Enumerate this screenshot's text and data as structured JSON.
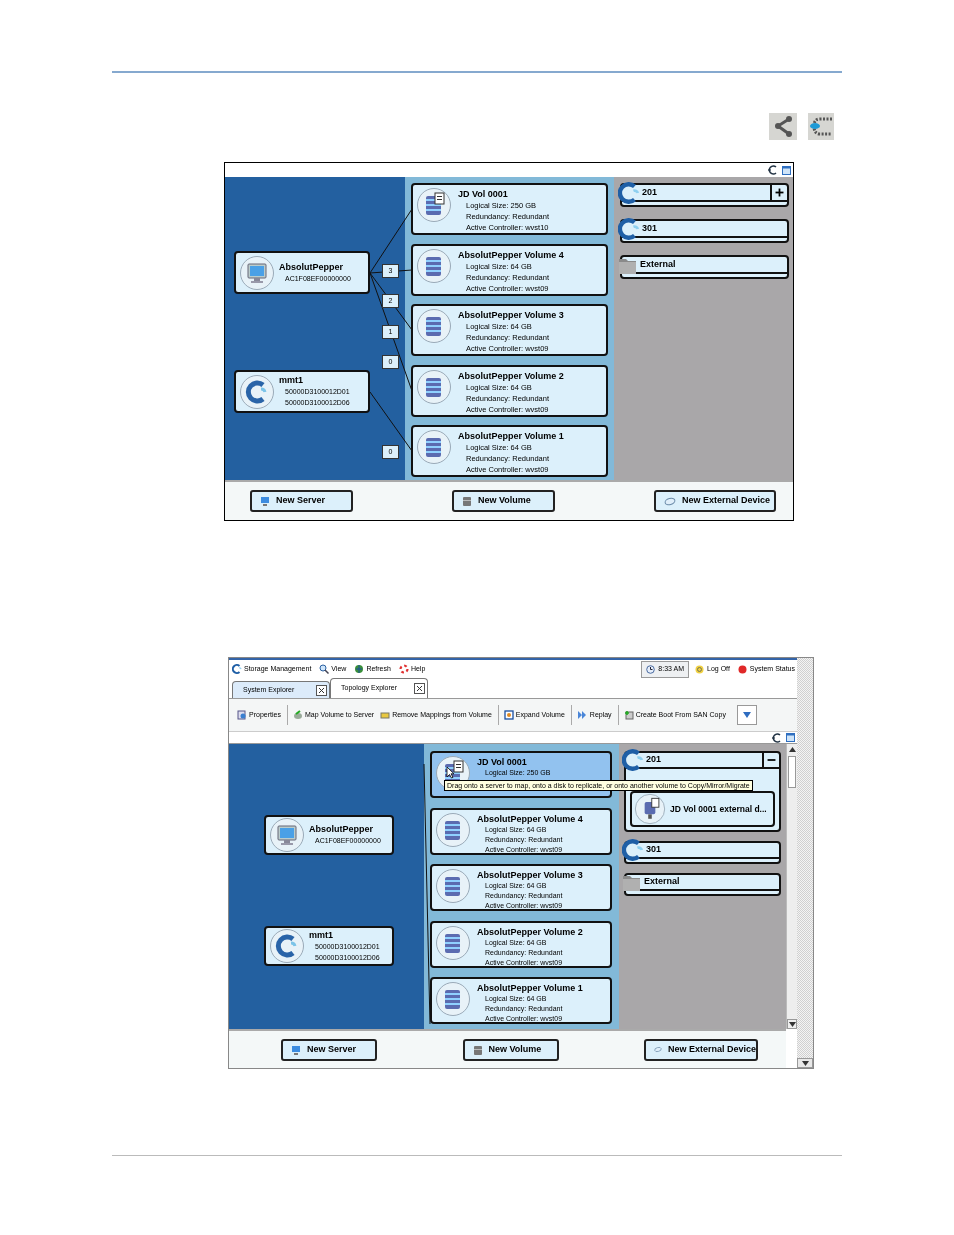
{
  "figures": [
    {
      "kind": "diagram",
      "topology": {
        "servers": [
          {
            "name": "AbsolutPepper",
            "kind": "server",
            "ids": [
              "AC1F08EF00000000"
            ]
          },
          {
            "name": "mmt1",
            "kind": "system",
            "ids": [
              "50000D3100012D01",
              "50000D3100012D06"
            ]
          }
        ],
        "mapping_counts": [
          "3",
          "2",
          "1",
          "0",
          "0"
        ],
        "volumes": [
          {
            "name": "JD Vol 0001",
            "kind": "copy",
            "selected": false,
            "details": [
              "Logical Size: 250 GB",
              "Redundancy: Redundant",
              "Active Controller: wvst10"
            ]
          },
          {
            "name": "AbsolutPepper Volume 4",
            "kind": "plain",
            "selected": false,
            "details": [
              "Logical Size: 64 GB",
              "Redundancy: Redundant",
              "Active Controller: wvst09"
            ]
          },
          {
            "name": "AbsolutPepper Volume 3",
            "kind": "plain",
            "selected": false,
            "details": [
              "Logical Size: 64 GB",
              "Redundancy: Redundant",
              "Active Controller: wvst09"
            ]
          },
          {
            "name": "AbsolutPepper Volume 2",
            "kind": "plain",
            "selected": false,
            "details": [
              "Logical Size: 64 GB",
              "Redundancy: Redundant",
              "Active Controller: wvst09"
            ]
          },
          {
            "name": "AbsolutPepper Volume 1",
            "kind": "plain",
            "selected": false,
            "details": [
              "Logical Size: 64 GB",
              "Redundancy: Redundant",
              "Active Controller: wvst09"
            ]
          }
        ],
        "devices": [
          {
            "name": "201",
            "kind": "replay",
            "expanded": false
          },
          {
            "name": "301",
            "kind": "replay"
          },
          {
            "name": "External",
            "kind": "folder"
          }
        ],
        "buttons": [
          "New Server",
          "New Volume",
          "New External Device"
        ]
      }
    },
    {
      "kind": "window",
      "menu": [
        "Storage Management",
        "View",
        "Refresh",
        "Help"
      ],
      "status": {
        "time": "8:33 AM",
        "items": [
          "Log Off",
          "System Status"
        ]
      },
      "tabs": [
        {
          "label": "System Explorer",
          "selected": false
        },
        {
          "label": "Topology Explorer",
          "selected": true
        }
      ],
      "toolbar": [
        [
          "Properties"
        ],
        [
          "Map Volume to Server",
          "Remove Mappings from Volume"
        ],
        [
          "Expand Volume"
        ],
        [
          "Replay"
        ],
        [
          "Create Boot From SAN Copy"
        ]
      ],
      "topology": {
        "servers": [
          {
            "name": "AbsolutPepper",
            "kind": "server",
            "ids": [
              "AC1F08EF00000000"
            ]
          },
          {
            "name": "mmt1",
            "kind": "system",
            "ids": [
              "50000D3100012D01",
              "50000D3100012D06"
            ]
          }
        ],
        "volumes": [
          {
            "name": "JD Vol 0001",
            "kind": "copy",
            "selected": true,
            "details": [
              "Logical Size: 250 GB"
            ],
            "tooltip": "Drag onto a server to map, onto a disk to replicate, or onto another volume to Copy/Mirror/Migrate"
          },
          {
            "name": "AbsolutPepper Volume 4",
            "kind": "plain",
            "selected": false,
            "details": [
              "Logical Size: 64 GB",
              "Redundancy: Redundant",
              "Active Controller: wvst09"
            ]
          },
          {
            "name": "AbsolutPepper Volume 3",
            "kind": "plain",
            "selected": false,
            "details": [
              "Logical Size: 64 GB",
              "Redundancy: Redundant",
              "Active Controller: wvst09"
            ]
          },
          {
            "name": "AbsolutPepper Volume 2",
            "kind": "plain",
            "selected": false,
            "details": [
              "Logical Size: 64 GB",
              "Redundancy: Redundant",
              "Active Controller: wvst09"
            ]
          },
          {
            "name": "AbsolutPepper Volume 1",
            "kind": "plain",
            "selected": false,
            "details": [
              "Logical Size: 64 GB",
              "Redundancy: Redundant",
              "Active Controller: wvst09"
            ]
          }
        ],
        "devices": [
          {
            "name": "201",
            "kind": "replay",
            "expanded": true,
            "children": [
              {
                "name": "JD Vol 0001 external d..."
              }
            ]
          },
          {
            "name": "301",
            "kind": "replay"
          },
          {
            "name": "External",
            "kind": "folder"
          }
        ],
        "buttons": [
          "New Server",
          "New Volume",
          "New External Device"
        ]
      }
    }
  ]
}
